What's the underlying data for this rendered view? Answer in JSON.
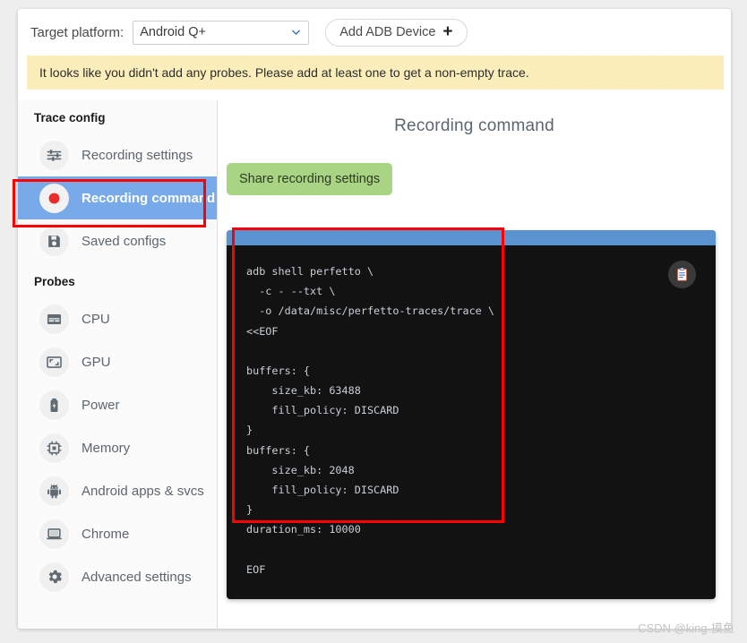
{
  "topbar": {
    "target_platform_label": "Target platform:",
    "platform_value": "Android Q+",
    "add_adb_label": "Add ADB Device",
    "plus_glyph": "+"
  },
  "warning": {
    "text": "It looks like you didn't add any probes. Please add at least one to get a non-empty trace."
  },
  "sidebar": {
    "trace_config_title": "Trace config",
    "trace_config_items": [
      {
        "label": "Recording settings",
        "icon": "sliders-icon",
        "active": false
      },
      {
        "label": "Recording command",
        "icon": "record-icon",
        "active": true
      },
      {
        "label": "Saved configs",
        "icon": "save-disk-icon",
        "active": false
      }
    ],
    "probes_title": "Probes",
    "probe_items": [
      {
        "label": "CPU",
        "icon": "cpu-icon"
      },
      {
        "label": "GPU",
        "icon": "gpu-icon"
      },
      {
        "label": "Power",
        "icon": "battery-icon"
      },
      {
        "label": "Memory",
        "icon": "memory-chip-icon"
      },
      {
        "label": "Android apps & svcs",
        "icon": "android-icon"
      },
      {
        "label": "Chrome",
        "icon": "laptop-icon"
      },
      {
        "label": "Advanced settings",
        "icon": "gear-icon"
      }
    ]
  },
  "main": {
    "title": "Recording command",
    "share_button_label": "Share recording settings",
    "copy_icon": "clipboard-copy-icon",
    "command": "adb shell perfetto \\\n  -c - --txt \\\n  -o /data/misc/perfetto-traces/trace \\\n<<EOF\n\nbuffers: {\n    size_kb: 63488\n    fill_policy: DISCARD\n}\nbuffers: {\n    size_kb: 2048\n    fill_policy: DISCARD\n}\nduration_ms: 10000\n\nEOF"
  },
  "annotations": {
    "highlight_color": "#fe0000",
    "boxes": [
      "recording-command-nav",
      "recording-command-code"
    ]
  },
  "watermark": {
    "text": "CSDN @king-摸鱼"
  },
  "colors": {
    "accent_blue": "#78a9e8",
    "code_header_blue": "#5b92d0",
    "code_bg": "#121212",
    "warning_bg": "#fbeeba",
    "share_green": "#a8d484",
    "record_red": "#ea2b2b"
  }
}
